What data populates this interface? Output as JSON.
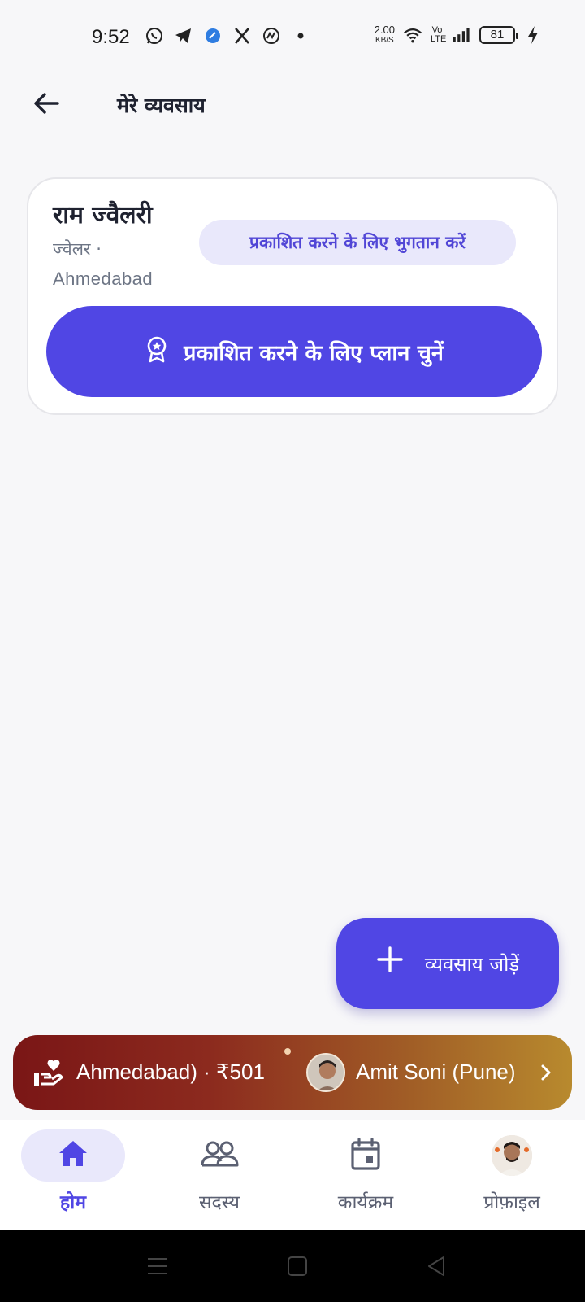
{
  "status_bar": {
    "time": "9:52",
    "net_speed_value": "2.00",
    "net_speed_unit": "KB/S",
    "volte": "Vo LTE",
    "battery": "81",
    "left_icons": [
      "whatsapp-icon",
      "telegram-icon",
      "app-icon",
      "x-icon",
      "app2-icon",
      "dot-icon"
    ],
    "right_icons": [
      "wifi-icon",
      "signal-icon",
      "charging-icon"
    ]
  },
  "header": {
    "back_icon": "arrow-left-icon",
    "title": "मेरे व्यवसाय"
  },
  "business_card": {
    "name": "राम ज्वैलरी",
    "category": "ज्वेलर ·",
    "city": "Ahmedabad",
    "pay_chip_label": "प्रकाशित करने के लिए भुगतान करें",
    "plan_button_label": "प्रकाशित करने के लिए प्लान चुनें",
    "plan_button_icon": "award-badge-icon"
  },
  "fab": {
    "icon": "plus-icon",
    "label": "व्यवसाय जोड़ें"
  },
  "ticker": {
    "icon": "donation-hand-heart-icon",
    "text1": "Ahmedabad) · ₹501",
    "text2": "Amit Soni (Pune)",
    "chevron": "chevron-right-icon"
  },
  "bottom_nav": {
    "items": [
      {
        "label": "होम",
        "icon": "home-icon",
        "active": true
      },
      {
        "label": "सदस्य",
        "icon": "members-icon",
        "active": false
      },
      {
        "label": "कार्यक्रम",
        "icon": "calendar-icon",
        "active": false
      },
      {
        "label": "प्रोफ़ाइल",
        "icon": "profile-avatar",
        "active": false
      }
    ]
  },
  "colors": {
    "accent": "#5046e4",
    "accent_light": "#e9e8fb",
    "background": "#f7f7f9",
    "ticker_start": "#7a1616",
    "ticker_end": "#b88a2e"
  }
}
